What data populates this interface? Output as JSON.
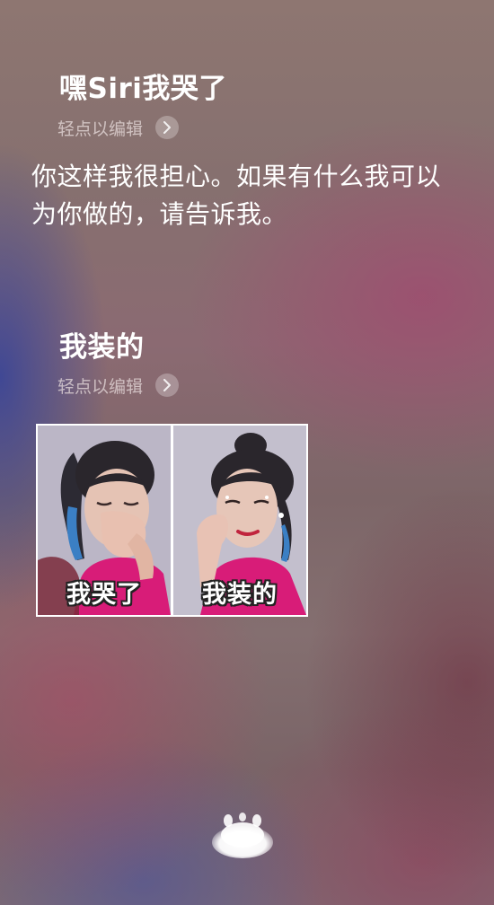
{
  "conversation": {
    "first_query": "嘿Siri我哭了",
    "first_edit_hint": "轻点以编辑",
    "siri_response": "你这样我很担心。如果有什么我可以为你做的，请告诉我。",
    "second_query": "我装的",
    "second_edit_hint": "轻点以编辑"
  },
  "image_result": {
    "left_caption": "我哭了",
    "right_caption": "我装的"
  },
  "icons": {
    "edit_chevron": "chevron-right-icon",
    "siri": "siri-orb-icon"
  },
  "colors": {
    "text": "#ffffff",
    "hint_text": "#e2d6d6",
    "accent_pink": "#d81c78"
  }
}
